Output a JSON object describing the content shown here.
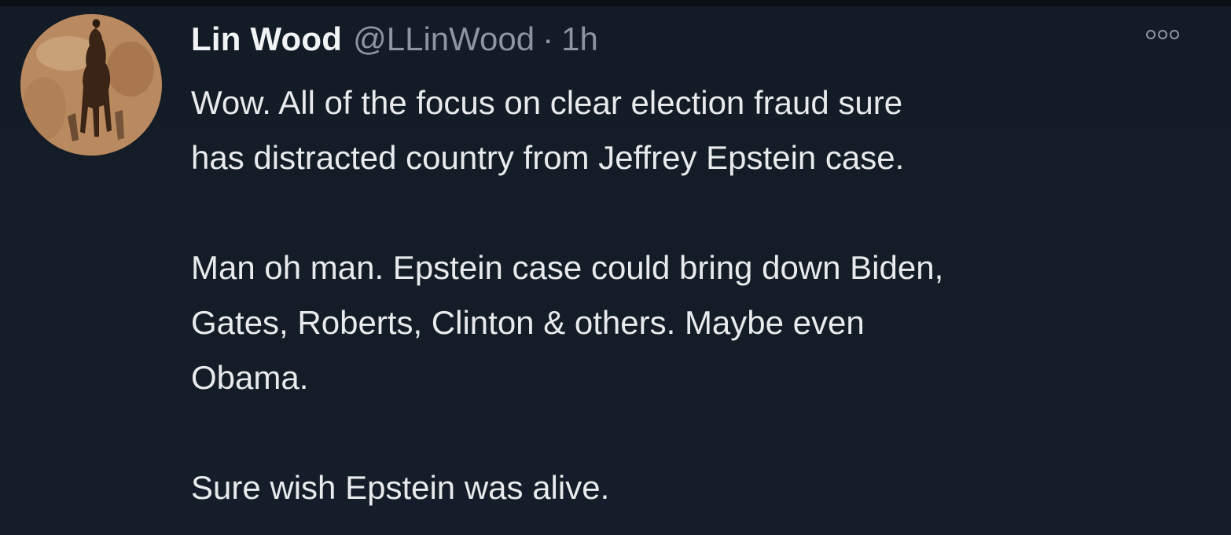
{
  "tweet": {
    "author_name": "Lin Wood",
    "handle": "@LLinWood",
    "separator": "·",
    "time": "1h",
    "avatar_icon": "avatar-horse-rider-icon",
    "more_icon": "more-options-icon",
    "paragraphs": [
      {
        "lines": [
          "Wow. All of the focus on clear election fraud sure",
          "has distracted country from Jeffrey Epstein case."
        ]
      },
      {
        "lines": [
          "Man oh man. Epstein case could bring down Biden,",
          "Gates, Roberts, Clinton & others. Maybe even",
          "Obama."
        ]
      },
      {
        "lines": [
          "Sure wish Epstein was alive."
        ]
      }
    ]
  },
  "colors": {
    "background": "#141d29",
    "text": "#e8eaec",
    "muted": "#8d96a0"
  }
}
